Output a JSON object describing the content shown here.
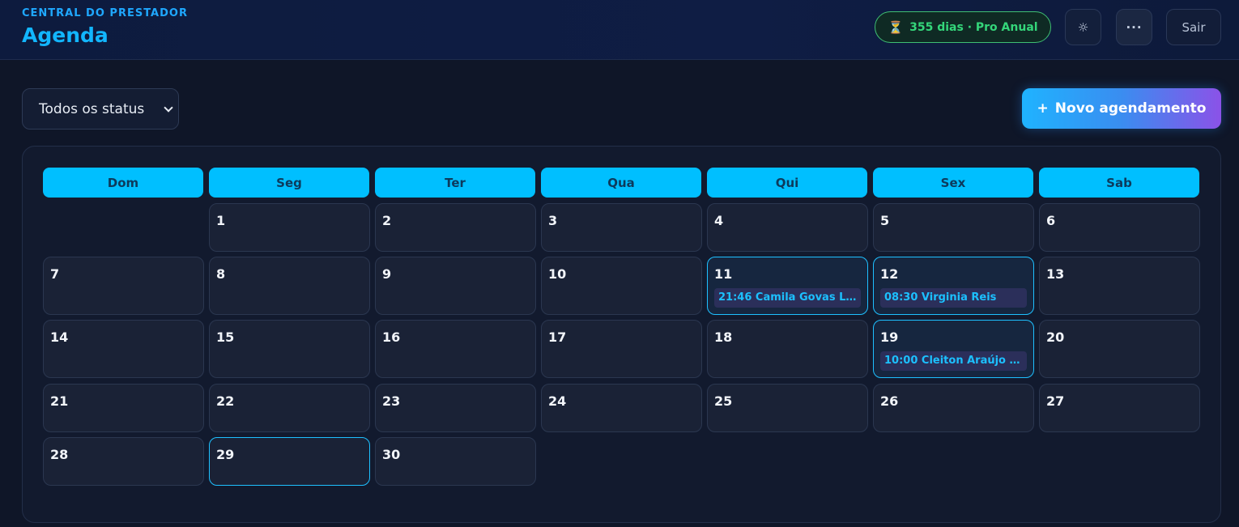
{
  "header": {
    "subtitle": "CENTRAL DO PRESTADOR",
    "title": "Agenda",
    "plan_icon": "⏳",
    "plan_badge": "355 dias · Pro Anual",
    "theme_icon": "☼",
    "more_icon": "···",
    "logout_label": "Sair"
  },
  "toolbar": {
    "status_filter": "Todos os status",
    "new_button_icon": "+",
    "new_button_label": "Novo agendamento"
  },
  "calendar": {
    "weekdays": [
      "Dom",
      "Seg",
      "Ter",
      "Qua",
      "Qui",
      "Sex",
      "Sab"
    ],
    "days": [
      "1",
      "2",
      "3",
      "4",
      "5",
      "6",
      "7",
      "8",
      "9",
      "10",
      "11",
      "12",
      "13",
      "14",
      "15",
      "16",
      "17",
      "18",
      "19",
      "20",
      "21",
      "22",
      "23",
      "24",
      "25",
      "26",
      "27",
      "28",
      "29",
      "30"
    ],
    "events": {
      "11": "21:46 Camila Govas La...",
      "12": "08:30 Virginia Reis",
      "19": "10:00 Cleiton Araújo Pe..."
    },
    "today": "29"
  },
  "colors": {
    "accent": "#00bfff",
    "badge_green": "#34d67a",
    "event_text": "#1cc0ff"
  }
}
